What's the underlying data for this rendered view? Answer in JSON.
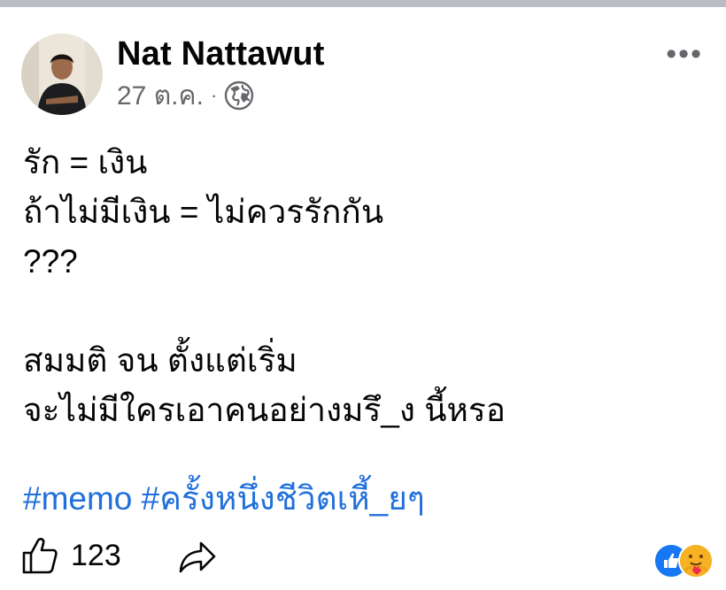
{
  "post": {
    "author": "Nat Nattawut",
    "date": "27 ต.ค.",
    "separator": "·",
    "privacy_icon": "globe-icon",
    "more_label": "•••",
    "lines": [
      "รัก = เงิน",
      "ถ้าไม่มีเงิน = ไม่ควรรักกัน",
      "???",
      "",
      "สมมติ จน ตั้งแต่เริ่ม",
      "จะไม่มีใครเอาคนอย่างมรึ_ง นี้หรอ"
    ],
    "hashtags": [
      "#memo",
      "#ครั้งหนึ่งชีวิตเหี้_ยๆ"
    ]
  },
  "footer": {
    "like_icon": "thumbs-up-icon",
    "like_count": "123",
    "share_icon": "share-arrow-icon",
    "reactions": [
      "like-reaction-icon",
      "care-reaction-icon"
    ]
  },
  "colors": {
    "text": "#050505",
    "meta": "#65676b",
    "hashtag": "#216fdb",
    "like_blue": "#1877f2",
    "care_yellow": "#f7b125"
  }
}
